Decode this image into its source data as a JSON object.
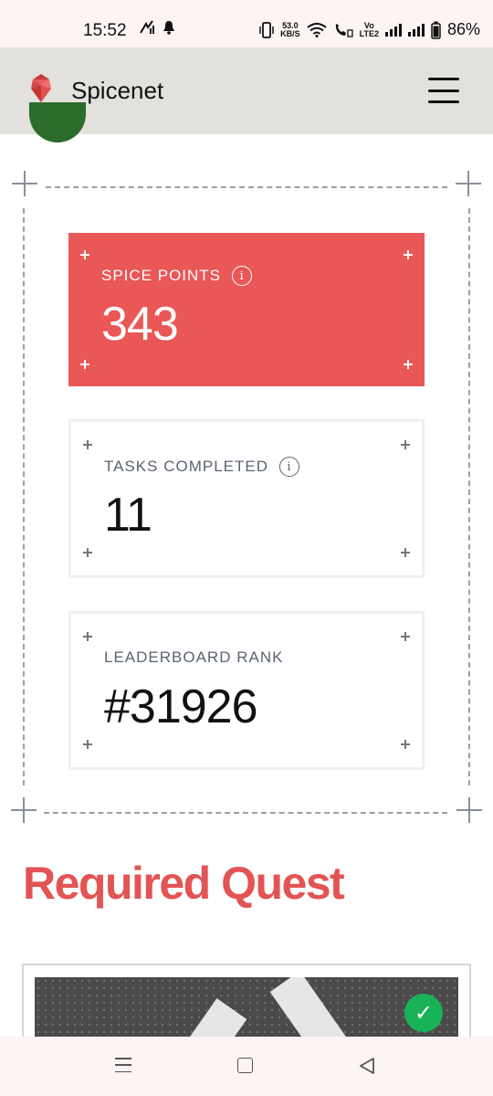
{
  "status_bar": {
    "time": "15:52",
    "net_speed_value": "53.0",
    "net_speed_unit": "KB/S",
    "volte_top": "Vo",
    "volte_bottom": "LTE2",
    "battery": "86%"
  },
  "header": {
    "app_name": "Spicenet",
    "logo_icon": "spicenet-logo-icon",
    "menu_icon": "hamburger-menu-icon"
  },
  "stats": {
    "points": {
      "label": "SPICE POINTS",
      "value": "343",
      "info_icon": "i"
    },
    "tasks": {
      "label": "TASKS COMPLETED",
      "value": "11",
      "info_icon": "i"
    },
    "rank": {
      "label": "LEADERBOARD RANK",
      "value": "#31926"
    }
  },
  "quest": {
    "title": "Required Quest",
    "status_icon": "checkmark-icon",
    "check_glyph": "✓"
  },
  "colors": {
    "accent_red": "#ea5757",
    "quest_title": "#e35454",
    "header_bg": "#e3e1dd",
    "success_green": "#18b356"
  },
  "nav_bar": {
    "recent_icon": "recent-apps-icon",
    "home_icon": "home-icon",
    "back_icon": "back-icon"
  }
}
